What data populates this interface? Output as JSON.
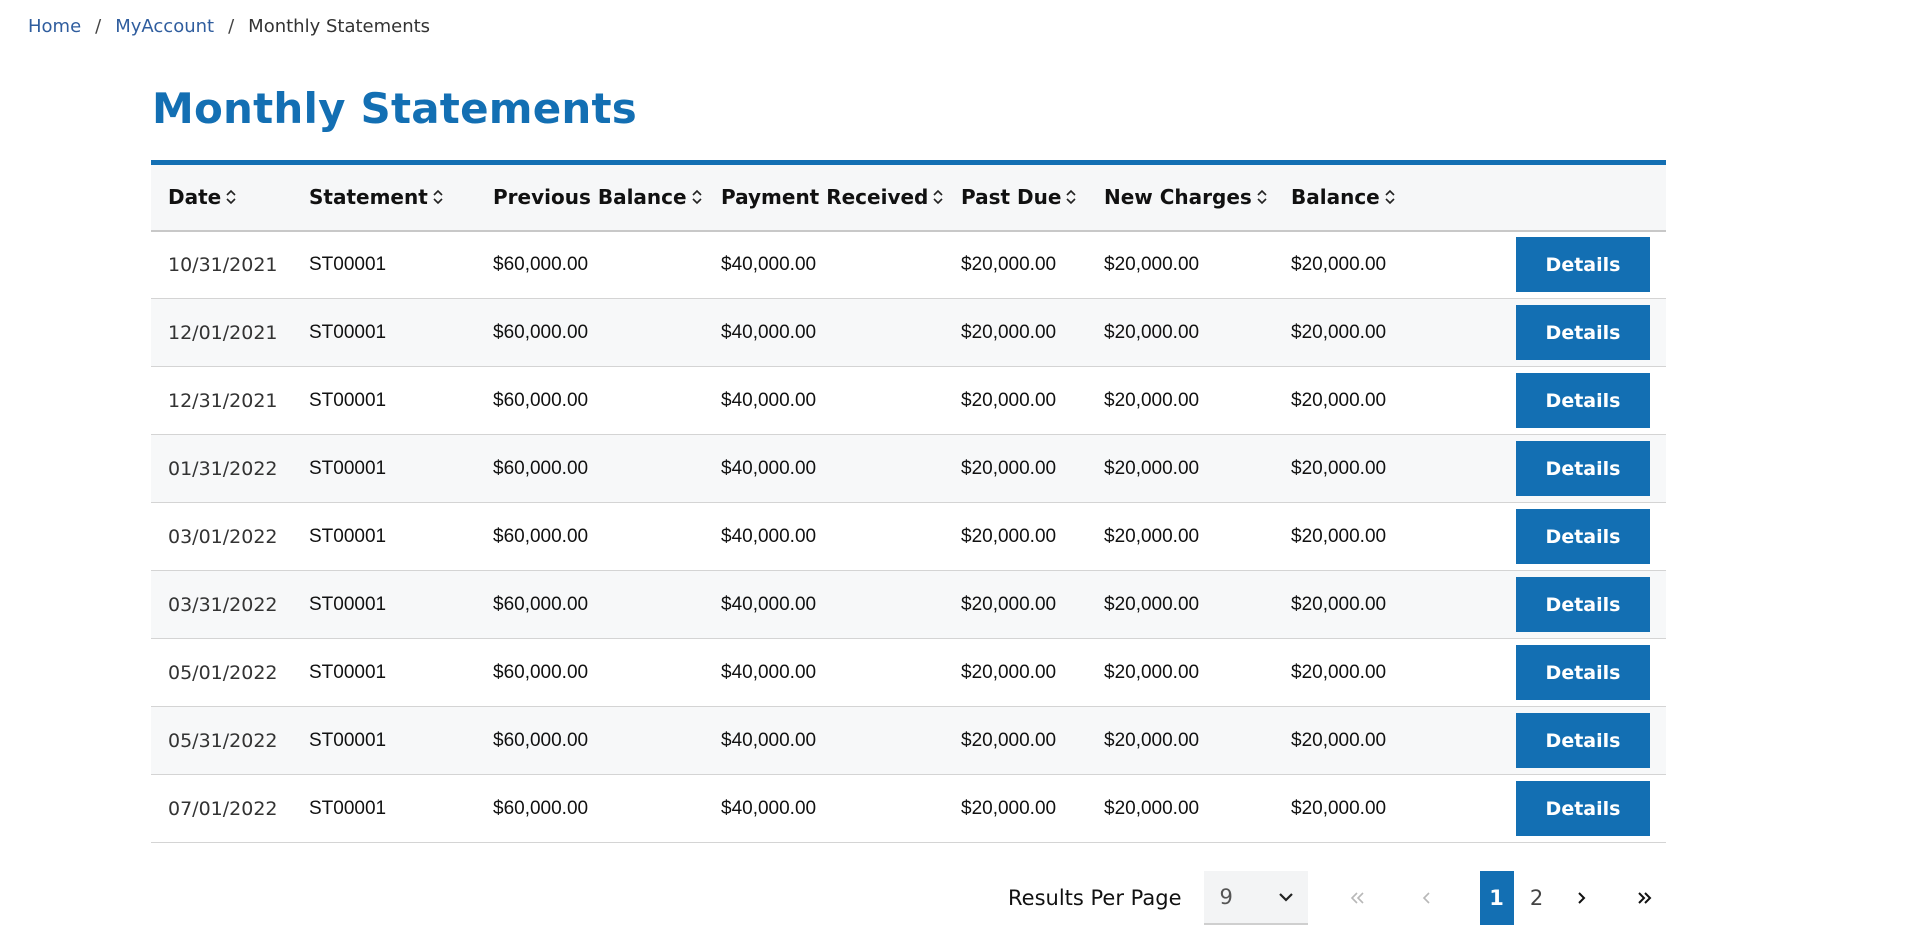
{
  "breadcrumb": {
    "home": "Home",
    "myaccount": "MyAccount",
    "current": "Monthly Statements",
    "separator": "/"
  },
  "page": {
    "title": "Monthly Statements"
  },
  "table": {
    "columns": [
      "Date",
      "Statement",
      "Previous Balance",
      "Payment Received",
      "Past Due",
      "New Charges",
      "Balance"
    ],
    "details_label": "Details",
    "rows": [
      [
        "10/31/2021",
        "ST00001",
        "$60,000.00",
        "$40,000.00",
        "$20,000.00",
        "$20,000.00",
        "$20,000.00"
      ],
      [
        "12/01/2021",
        "ST00001",
        "$60,000.00",
        "$40,000.00",
        "$20,000.00",
        "$20,000.00",
        "$20,000.00"
      ],
      [
        "12/31/2021",
        "ST00001",
        "$60,000.00",
        "$40,000.00",
        "$20,000.00",
        "$20,000.00",
        "$20,000.00"
      ],
      [
        "01/31/2022",
        "ST00001",
        "$60,000.00",
        "$40,000.00",
        "$20,000.00",
        "$20,000.00",
        "$20,000.00"
      ],
      [
        "03/01/2022",
        "ST00001",
        "$60,000.00",
        "$40,000.00",
        "$20,000.00",
        "$20,000.00",
        "$20,000.00"
      ],
      [
        "03/31/2022",
        "ST00001",
        "$60,000.00",
        "$40,000.00",
        "$20,000.00",
        "$20,000.00",
        "$20,000.00"
      ],
      [
        "05/01/2022",
        "ST00001",
        "$60,000.00",
        "$40,000.00",
        "$20,000.00",
        "$20,000.00",
        "$20,000.00"
      ],
      [
        "05/31/2022",
        "ST00001",
        "$60,000.00",
        "$40,000.00",
        "$20,000.00",
        "$20,000.00",
        "$20,000.00"
      ],
      [
        "07/01/2022",
        "ST00001",
        "$60,000.00",
        "$40,000.00",
        "$20,000.00",
        "$20,000.00",
        "$20,000.00"
      ]
    ]
  },
  "pagination": {
    "results_per_page_label": "Results Per Page",
    "results_per_page_value": "9",
    "pages": [
      "1",
      "2"
    ],
    "current_page": "1"
  },
  "colors": {
    "accent": "#136fb3",
    "link": "#2f5d9e",
    "row_alt": "#f7f8f9"
  }
}
